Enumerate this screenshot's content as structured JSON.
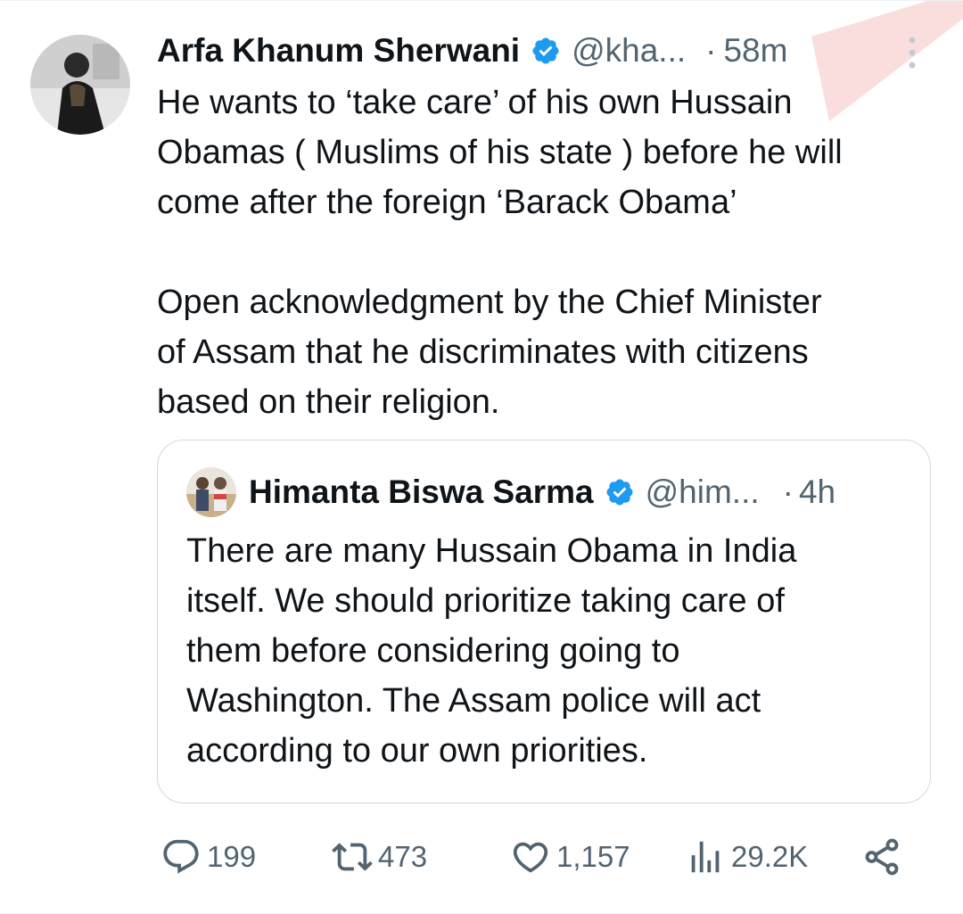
{
  "tweet": {
    "author_name": "Arfa Khanum Sherwani",
    "handle": "@kha...",
    "separator": "·",
    "time": "58m",
    "text": "He wants to ‘take care’ of his own Hussain\nObamas ( Muslims of his state ) before he will\ncome after the foreign ‘Barack Obama’\n\nOpen acknowledgment by the Chief Minister\nof Assam that he discriminates with citizens\nbased on their religion."
  },
  "quote": {
    "author_name": "Himanta Biswa Sarma",
    "handle": "@him...",
    "separator": "·",
    "time": "4h",
    "text": "There are many Hussain Obama in India\nitself. We should prioritize taking care of\nthem before considering going to\nWashington. The Assam police will act\naccording to our own priorities."
  },
  "actions": {
    "replies": "199",
    "retweets": "473",
    "likes": "1,157",
    "views": "29.2K"
  },
  "icons": {
    "verified": "verified-badge-icon",
    "more": "more-vertical-icon",
    "reply": "reply-icon",
    "retweet": "retweet-icon",
    "like": "heart-icon",
    "views": "views-icon",
    "share": "share-icon"
  },
  "colors": {
    "verified": "#1d9bf0",
    "text_primary": "#0f1419",
    "text_secondary": "#536471",
    "border": "#cfd9de"
  }
}
